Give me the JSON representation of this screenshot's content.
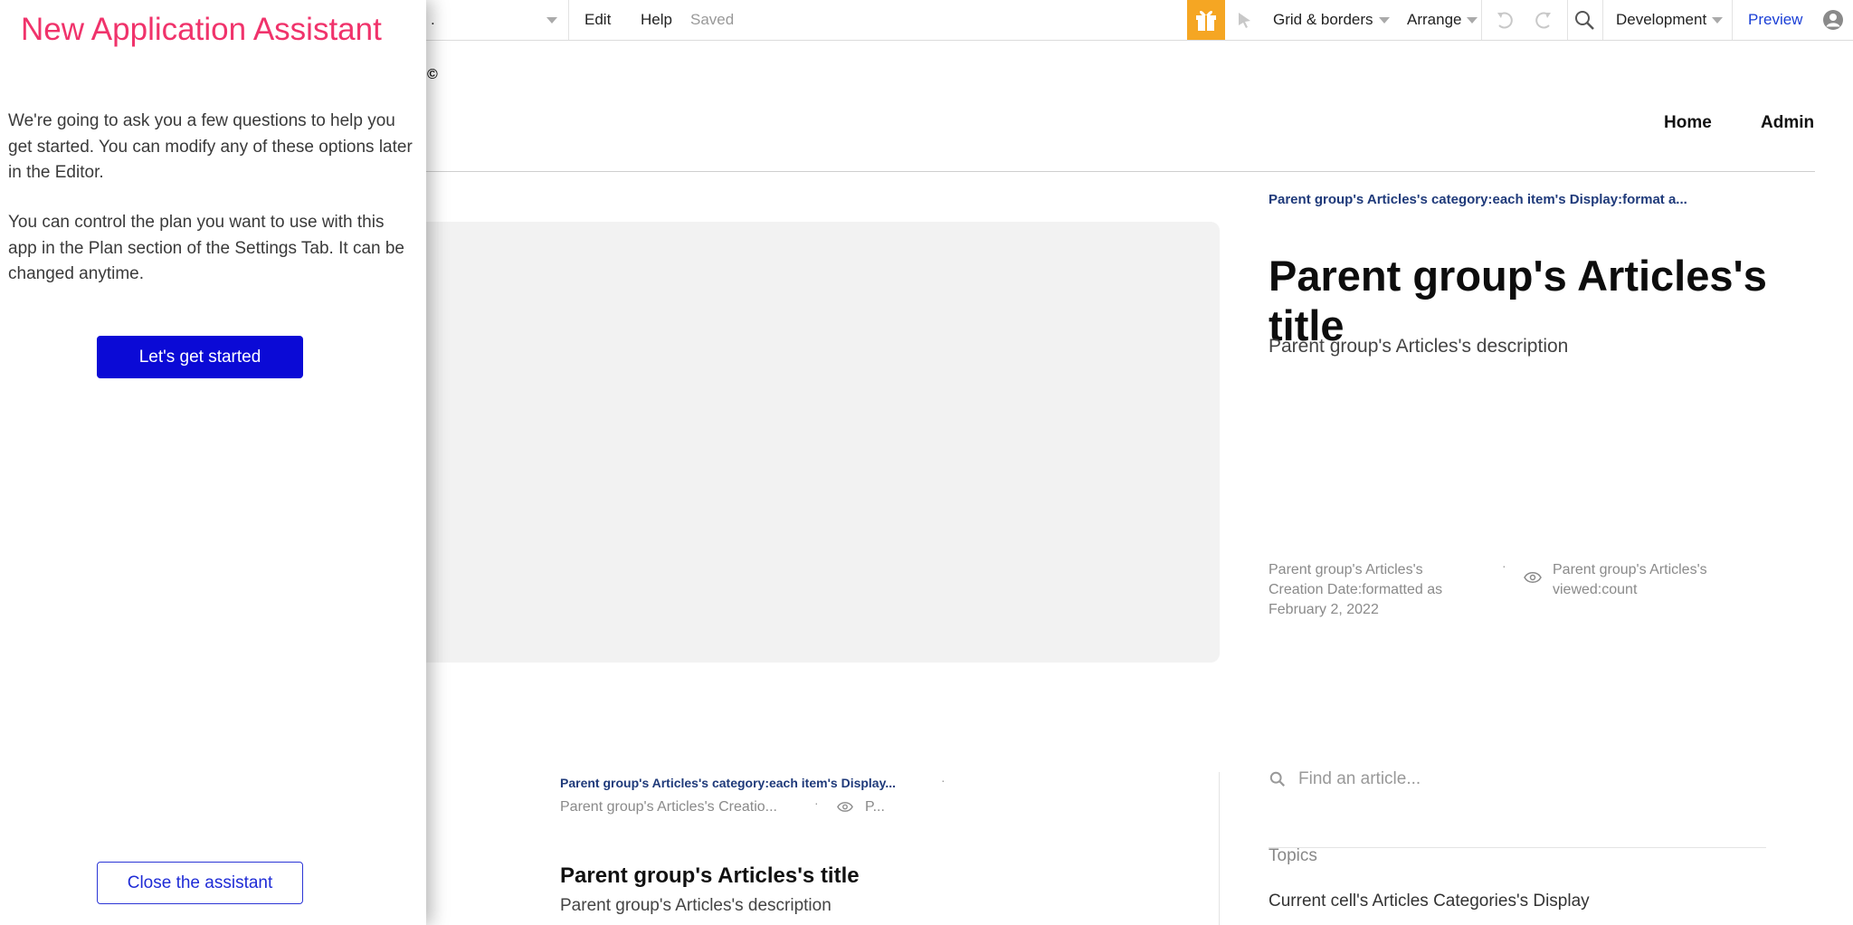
{
  "toolbar": {
    "page_dropdown": ".",
    "edit": "Edit",
    "help": "Help",
    "saved": "Saved",
    "grid_borders": "Grid & borders",
    "arrange": "Arrange",
    "environment": "Development",
    "preview": "Preview",
    "icons": [
      "gift-icon",
      "pointer-icon",
      "undo-icon",
      "redo-icon",
      "search-icon",
      "user-icon"
    ]
  },
  "page": {
    "logo_mark": "©",
    "nav": {
      "home": "Home",
      "admin": "Admin"
    },
    "featured": {
      "category": "Parent group's Articles's category:each item's Display:format a...",
      "title": "Parent group's Articles's title",
      "description": "Parent group's Articles's description",
      "date_lines": [
        "Parent group's Articles's",
        "Creation Date:formatted as",
        "February 2, 2022"
      ],
      "separator": "·",
      "views_lines": [
        "Parent group's Articles's",
        "viewed:count"
      ]
    },
    "list_item": {
      "category": "Parent group's Articles's category:each item's Display...",
      "separator": "·",
      "date": "Parent group's Articles's Creatio...",
      "views": "P...",
      "title": "Parent group's Articles's title",
      "description": "Parent group's Articles's description"
    },
    "sidebar": {
      "search_placeholder": "Find an article...",
      "topics_label": "Topics",
      "topic_item": "Current cell's Articles Categories's Display"
    }
  },
  "assistant": {
    "title": "New Application Assistant",
    "paragraph_1": "We're going to ask you a few questions to help you get started. You can modify any of these options later in the Editor.",
    "paragraph_2": "You can control the plan you want to use with this app in the Plan section of the Settings Tab. It can be changed anytime.",
    "start_button": "Let's get started",
    "close_button": "Close the assistant"
  },
  "colors": {
    "assistant_title": "#f0336b",
    "primary_button": "#0b0ad6",
    "link": "#1a3fd6",
    "gift_accent": "#f5a623",
    "category_text": "#1f3a7a"
  }
}
